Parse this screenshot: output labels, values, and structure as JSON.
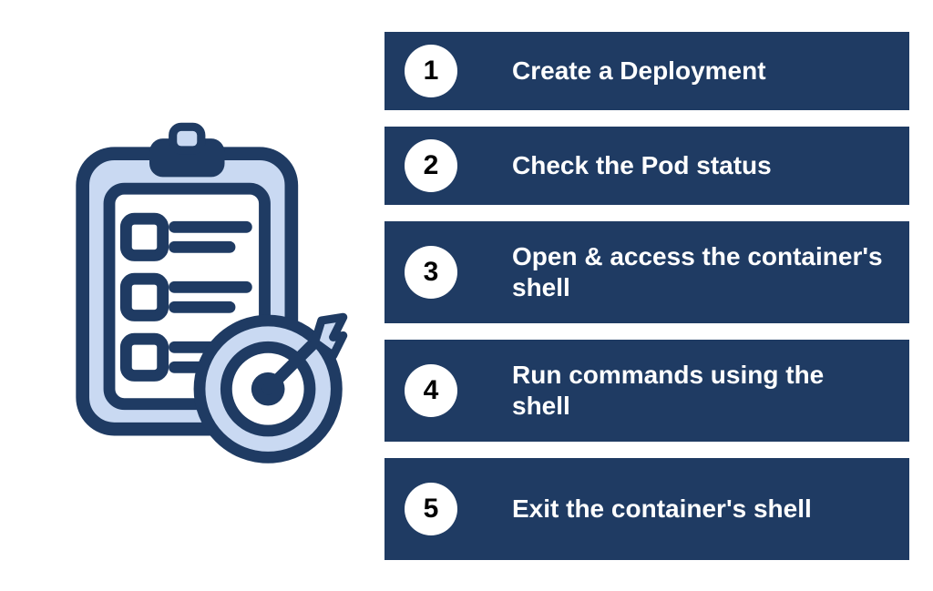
{
  "steps": [
    {
      "n": "1",
      "label": "Create a Deployment"
    },
    {
      "n": "2",
      "label": "Check the Pod status"
    },
    {
      "n": "3",
      "label": "Open & access the container's shell"
    },
    {
      "n": "4",
      "label": "Run commands using the shell"
    },
    {
      "n": "5",
      "label": "Exit the container's shell"
    }
  ],
  "colors": {
    "navy": "#1f3b63",
    "light_blue": "#c9d9f2",
    "white": "#ffffff"
  }
}
